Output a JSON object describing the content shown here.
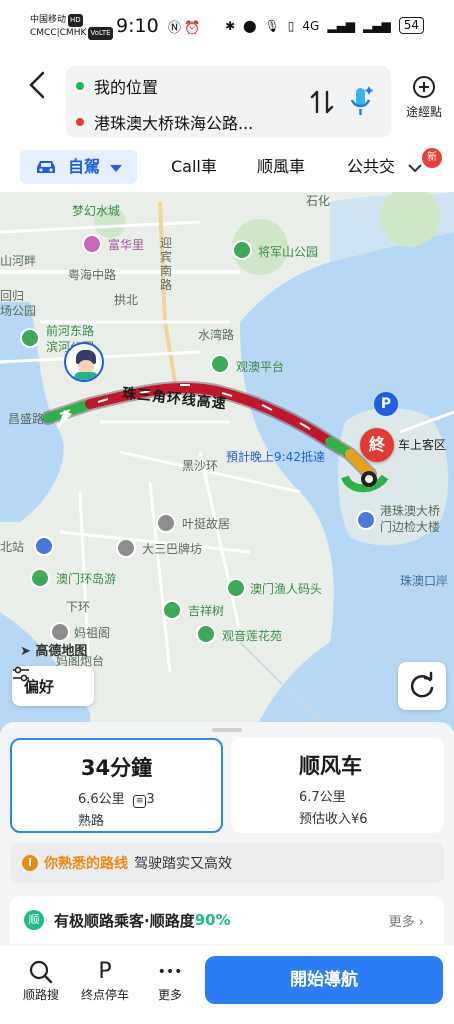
{
  "status_bar": {
    "carrier_line1": "中国移动",
    "carrier_line1_tag": "HD",
    "carrier_line2": "CMCC|CMHK",
    "carrier_line2_tag": "VoLTE",
    "time": "9:10",
    "network": "4G",
    "battery": "54"
  },
  "header": {
    "origin": "我的位置",
    "destination": "港珠澳大桥珠海公路...",
    "waypoint_label": "途經點",
    "origin_color": "#22b55a",
    "destination_color": "#e03b32"
  },
  "tabs": {
    "drive": "自駕",
    "call_car": "Call車",
    "carpool": "顺風車",
    "transit": "公共交",
    "new_badge": "新"
  },
  "map": {
    "labels": {
      "l1": "梦幻水城",
      "l2": "富华里",
      "l3": "迎宾南路",
      "l4": "石化",
      "l5": "山河畔",
      "l6": "粤海中路",
      "l7": "将军山公园",
      "l8": "拱北",
      "l9": "回归",
      "l10": "场公园",
      "l11": "前河东路",
      "l12": "滨河公园",
      "l13": "水湾路",
      "l14": "观澳平台",
      "l15": "昌盛路",
      "l16": "黑沙环",
      "l17": "叶挺故居",
      "l18": "大三巴牌坊",
      "l19": "北站",
      "l20": "澳门环岛游",
      "l21": "下环",
      "l22": "吉祥树",
      "l23": "澳门渔人码头",
      "l24": "妈祖阁",
      "l25": "观音莲花苑",
      "l26": "妈阁炮台",
      "l27": "高德地图",
      "l28": "港珠澳大桥",
      "l29": "门边检大楼",
      "l30": "车上客区",
      "l31": "珠澳口岸"
    },
    "route_name": "珠三角环线高速",
    "eta": "預計晚上9:42抵達",
    "end_marker": "終",
    "preference_button": "偏好",
    "route_colors": {
      "congested": "#c0172c",
      "clear": "#2fb04b",
      "slow": "#e7a21a"
    }
  },
  "routes": [
    {
      "title": "34分鐘",
      "line1": "6.6公里",
      "lights": "3",
      "line2": "熟路",
      "selected": true
    },
    {
      "title": "顺风车",
      "line1": "6.7公里",
      "line2": "预估收入¥6",
      "selected": false
    }
  ],
  "hint": {
    "icon": "i",
    "highlight": "你熟悉的路线",
    "text": "驾驶踏实又高效"
  },
  "promo": {
    "icon": "顺",
    "text": "有极顺路乘客·顺路度",
    "percent": "90%",
    "more": "更多 ›"
  },
  "bottom_bar": {
    "search_label": "顺路搜",
    "parking_label": "终点停车",
    "parking_glyph": "P",
    "more_label": "更多",
    "more_glyph": "•••",
    "start_button": "開始導航"
  }
}
